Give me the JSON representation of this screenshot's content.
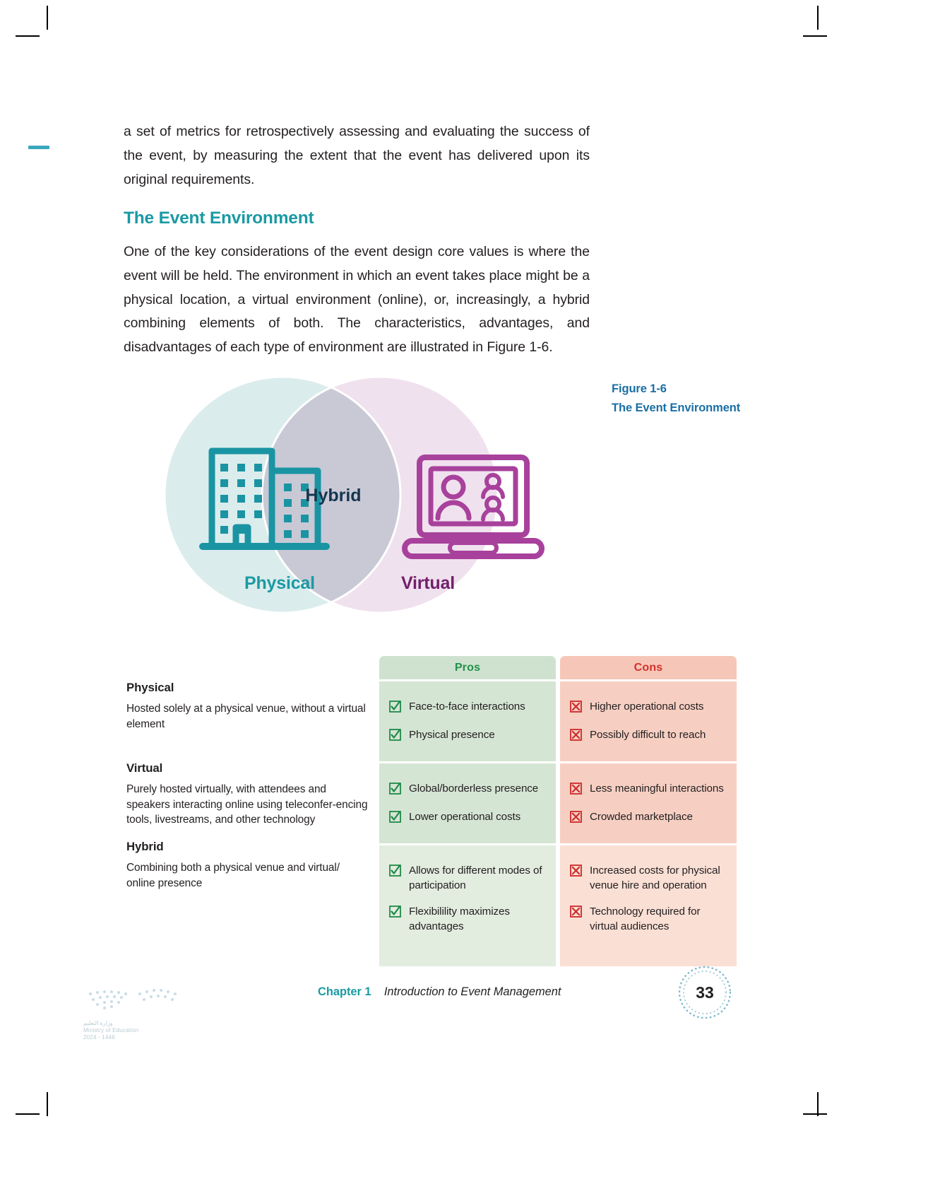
{
  "document": {
    "paragraphs": [
      "a set of metrics for retrospectively assessing and evaluating the success of the event, by measuring the extent that the event has delivered upon its original requirements."
    ],
    "section_heading": "The Event Environment",
    "intro_paragraph": "One of the key considerations of the event design core values is where the event will be held. The environment in which an event takes place might be a physical location, a virtual environment (online), or, increasingly, a hybrid combining elements of both. The characteristics, advantages, and disadvantages of each type of environment are illustrated in Figure 1-6."
  },
  "figure": {
    "number": "Figure 1-6",
    "title": "The Event Environment",
    "caption_color": "#1a6fa5"
  },
  "venn": {
    "left_label": "Physical",
    "left_label_color": "#1a9aa3",
    "left_circle_color": "#dbecec",
    "left_icon": "office-buildings-icon",
    "left_icon_color": "#1a94a3",
    "right_label": "Virtual",
    "right_label_color": "#71206b",
    "right_circle_color": "#f0e1ee",
    "right_icon": "laptop-video-call-icon",
    "right_icon_color": "#a8419c",
    "overlap_label": "Hybrid",
    "overlap_label_color": "#16364f",
    "overlap_color": "#c9c9d6"
  },
  "environments": [
    {
      "name": "Physical",
      "description": "Hosted solely at a physical venue, without a virtual element"
    },
    {
      "name": "Virtual",
      "description": "Purely hosted virtually, with attendees and speakers interacting online using teleconfer-encing tools, livestreams, and other technology"
    },
    {
      "name": "Hybrid",
      "description": "Combining both a physical venue and virtual/ online presence"
    }
  ],
  "table": {
    "headers": {
      "pros": "Pros",
      "cons": "Cons",
      "pros_color": "#21914a",
      "cons_color": "#d6302a"
    },
    "rows": [
      {
        "pros": [
          "Face-to-face interactions",
          "Physical presence"
        ],
        "cons": [
          "Higher operational costs",
          "Possibly difficult to reach"
        ]
      },
      {
        "pros": [
          "Global/borderless presence",
          "Lower operational costs"
        ],
        "cons": [
          "Less meaningful interactions",
          "Crowded marketplace"
        ]
      },
      {
        "pros": [
          "Allows for different modes of participation",
          "Flexibilility maximizes advantages"
        ],
        "cons": [
          "Increased costs for physical venue hire and operation",
          "Technology required for virtual audiences"
        ]
      }
    ]
  },
  "footer": {
    "chapter_label": "Chapter 1",
    "chapter_title": "Introduction to Event Management",
    "page_number": "33",
    "accent_color": "#1a9aa3",
    "logo_line_1": "وزارة التعليم",
    "logo_line_2": "Ministry of Education",
    "logo_line_3": "2024 - 1446"
  }
}
